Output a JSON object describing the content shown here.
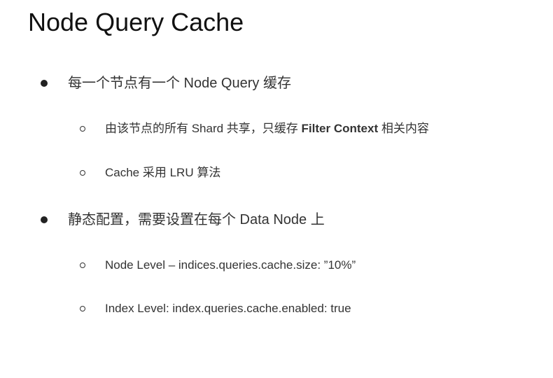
{
  "slide": {
    "title": "Node Query Cache"
  },
  "bullets": [
    {
      "text": "每一个节点有一个 Node Query 缓存",
      "sub": [
        {
          "text_before": "由该节点的所有 Shard 共享，只缓存 ",
          "text_bold": "Filter Context",
          "text_after": " 相关内容"
        },
        {
          "text": "Cache 采用 LRU 算法"
        }
      ]
    },
    {
      "text": "静态配置，需要设置在每个 Data Node 上",
      "sub": [
        {
          "text": "Node Level – indices.queries.cache.size: ”10%”"
        },
        {
          "text": "Index Level: index.queries.cache.enabled: true"
        }
      ]
    }
  ]
}
